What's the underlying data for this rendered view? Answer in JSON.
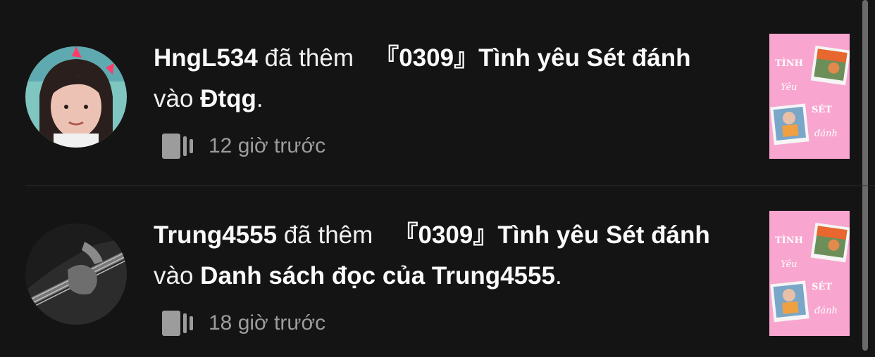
{
  "feed": {
    "items": [
      {
        "username": "HngL534",
        "verb": "đã thêm",
        "story_title": "『0309』Tình yêu Sét đánh",
        "preposition": "vào",
        "list_name": "Đtqg",
        "period": ".",
        "timestamp": "12 giờ trước",
        "avatar_icon": "user-avatar-photo",
        "meta_icon": "reading-list-icon"
      },
      {
        "username": "Trung4555",
        "verb": "đã thêm",
        "story_title": "『0309』Tình yêu Sét đánh",
        "preposition": "vào",
        "list_name": "Danh sách đọc của Trung4555",
        "period": ".",
        "timestamp": "18 giờ trước",
        "avatar_icon": "user-avatar-photo",
        "meta_icon": "reading-list-icon"
      }
    ],
    "cover": {
      "lines": [
        "TÌNH",
        "Yêu",
        "SÉT",
        "đánh"
      ],
      "background": "#f8a6cf"
    }
  },
  "colors": {
    "background": "#141414",
    "text": "#f0f0f0",
    "muted": "#9c9c9c",
    "divider": "#2e2e2e"
  }
}
